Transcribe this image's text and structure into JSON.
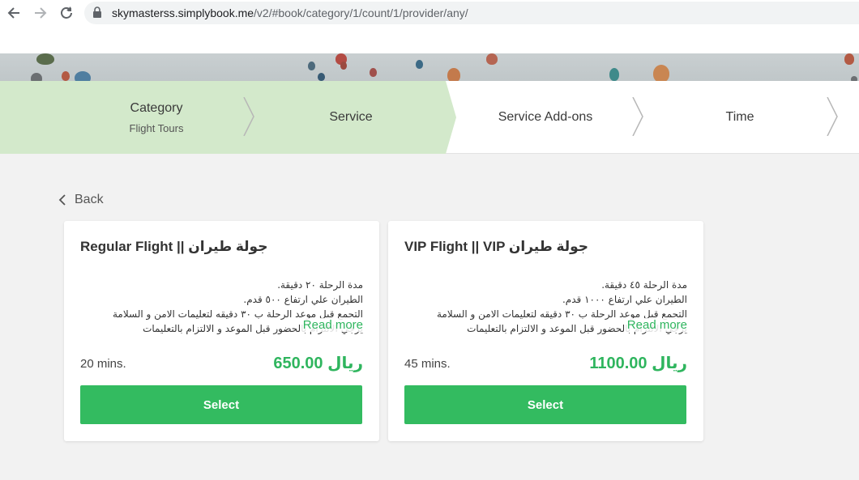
{
  "browser": {
    "url_host": "skymasterss.simplybook.me",
    "url_path": "/v2/#book/category/1/count/1/provider/any/"
  },
  "steps": [
    {
      "title": "Category",
      "subtitle": "Flight Tours",
      "active": true
    },
    {
      "title": "Service",
      "subtitle": "",
      "active": true
    },
    {
      "title": "Service Add-ons",
      "subtitle": "",
      "active": false
    },
    {
      "title": "Time",
      "subtitle": "",
      "active": false
    }
  ],
  "colors": {
    "accent": "#33bb60",
    "step_active": "#d3e9cb"
  },
  "back_label": "Back",
  "services": [
    {
      "title": "Regular Flight || جولة طيران",
      "description_lines": [
        "مدة الرحلة ٢٠ دقيقة.",
        "الطيران علي ارتفاع ٥٠٠ قدم.",
        "التجمع قبل موعد الرحلة ب ٣٠ دقيقه لتعليمات الامن و السلامة",
        "يرجي الالتزام بالحضور قبل الموعد و الالتزام بالتعليمات"
      ],
      "read_more": "Read more",
      "duration": "20 mins.",
      "price": "650.00 ريال",
      "select_label": "Select"
    },
    {
      "title": "VIP Flight || VIP جولة طيران",
      "description_lines": [
        "مدة الرحلة ٤٥ دقيقة.",
        "الطيران علي ارتفاع ١٠٠٠ قدم.",
        "التجمع قبل موعد الرحلة ب ٣٠ دقيقه لتعليمات الامن و السلامة",
        "يرجي الالتزام بالحضور قبل الموعد و الالتزام بالتعليمات"
      ],
      "read_more": "Read more",
      "duration": "45 mins.",
      "price": "1100.00 ريال",
      "select_label": "Select"
    }
  ]
}
